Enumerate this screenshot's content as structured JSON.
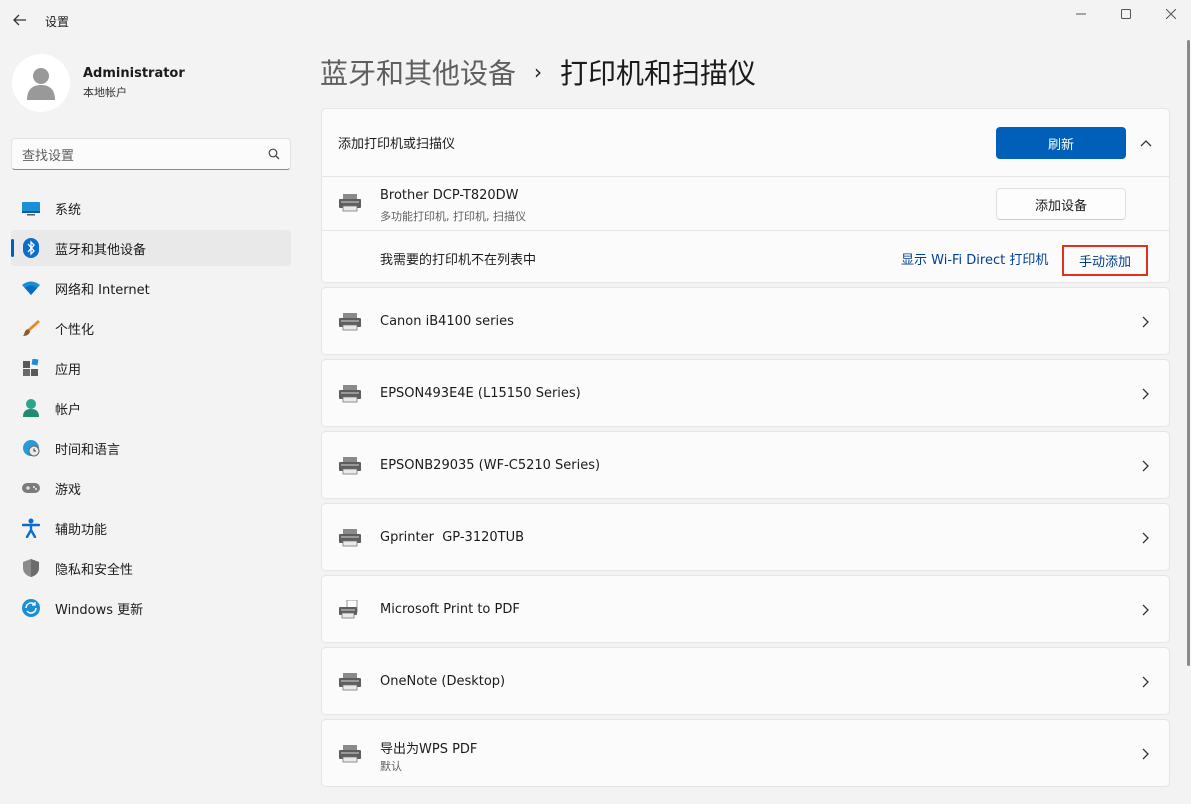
{
  "window": {
    "title": "设置",
    "minimize_icon": "minimize-icon",
    "maximize_icon": "maximize-icon",
    "close_icon": "close-icon"
  },
  "profile": {
    "name": "Administrator",
    "subtitle": "本地帐户"
  },
  "search": {
    "placeholder": "查找设置"
  },
  "nav": {
    "items": [
      {
        "label": "系统",
        "icon": "system-icon"
      },
      {
        "label": "蓝牙和其他设备",
        "icon": "bluetooth-icon",
        "active": true
      },
      {
        "label": "网络和 Internet",
        "icon": "wifi-icon"
      },
      {
        "label": "个性化",
        "icon": "brush-icon"
      },
      {
        "label": "应用",
        "icon": "apps-icon"
      },
      {
        "label": "帐户",
        "icon": "account-icon"
      },
      {
        "label": "时间和语言",
        "icon": "globe-clock-icon"
      },
      {
        "label": "游戏",
        "icon": "gamepad-icon"
      },
      {
        "label": "辅助功能",
        "icon": "accessibility-icon"
      },
      {
        "label": "隐私和安全性",
        "icon": "shield-icon"
      },
      {
        "label": "Windows 更新",
        "icon": "update-icon"
      }
    ]
  },
  "breadcrumb": {
    "parent": "蓝牙和其他设备",
    "separator": "›",
    "current": "打印机和扫描仪"
  },
  "add_section": {
    "label": "添加打印机或扫描仪",
    "refresh_label": "刷新",
    "found": {
      "name": "Brother DCP-T820DW",
      "sub": "多功能打印机, 打印机, 扫描仪",
      "add_label": "添加设备"
    },
    "missing_label": "我需要的打印机不在列表中",
    "wifi_direct_label": "显示 Wi-Fi Direct 打印机",
    "manual_label": "手动添加"
  },
  "printers": [
    {
      "name": "Canon iB4100 series",
      "sub": ""
    },
    {
      "name": "EPSON493E4E (L15150 Series)",
      "sub": ""
    },
    {
      "name": "EPSONB29035 (WF-C5210 Series)",
      "sub": ""
    },
    {
      "name": "Gprinter  GP-3120TUB",
      "sub": ""
    },
    {
      "name": "Microsoft Print to PDF",
      "sub": ""
    },
    {
      "name": "OneNote (Desktop)",
      "sub": ""
    },
    {
      "name": "导出为WPS PDF",
      "sub": "默认"
    }
  ],
  "colors": {
    "accent": "#005fb8",
    "link": "#003e92",
    "highlight_border": "#e0311f"
  }
}
